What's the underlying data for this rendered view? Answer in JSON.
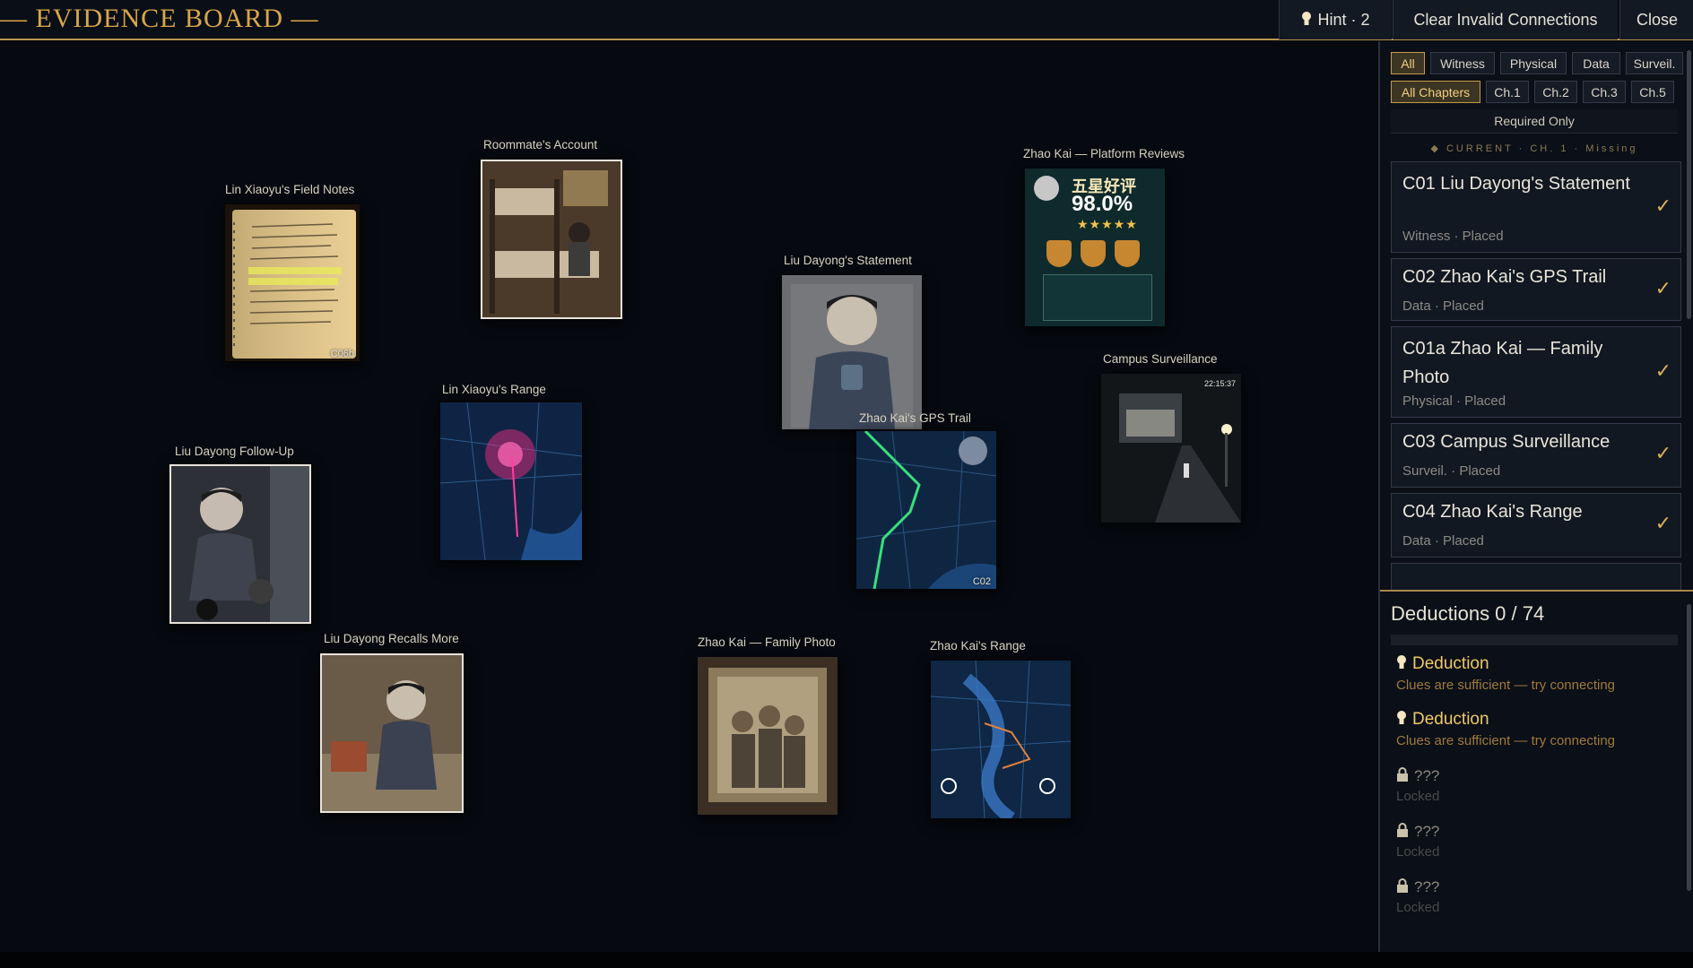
{
  "header": {
    "title": "— EVIDENCE BOARD —",
    "hint_label": "Hint · 2",
    "clear_label": "Clear Invalid Connections",
    "close_label": "Close"
  },
  "board": {
    "cards": [
      {
        "label": "Lin Xiaoyu's Field Notes",
        "code": "C06b"
      },
      {
        "label": "Roommate's Account",
        "code": ""
      },
      {
        "label": "Zhao Kai — Platform Reviews",
        "code": "",
        "badge_title": "五星好评",
        "badge_value": "98.0%"
      },
      {
        "label": "Liu Dayong's Statement",
        "code": ""
      },
      {
        "label": "Campus Surveillance",
        "code": "",
        "timestamp": "22:15:37"
      },
      {
        "label": "Lin Xiaoyu's Range",
        "code": ""
      },
      {
        "label": "Zhao Kai's GPS Trail",
        "code": "C02"
      },
      {
        "label": "Liu Dayong Follow-Up",
        "code": ""
      },
      {
        "label": "Liu Dayong Recalls More",
        "code": ""
      },
      {
        "label": "Zhao Kai — Family Photo",
        "code": ""
      },
      {
        "label": "Zhao Kai's Range",
        "code": ""
      }
    ]
  },
  "sidebar": {
    "type_filters": [
      "All",
      "Witness",
      "Physical",
      "Data",
      "Surveil."
    ],
    "chapter_filters": [
      "All Chapters",
      "Ch.1",
      "Ch.2",
      "Ch.3",
      "Ch.5"
    ],
    "required_only": "Required Only",
    "current_line": "◆ CURRENT · CH. 1 · Missing",
    "clues": [
      {
        "title": "C01  Liu Dayong's Statement",
        "sub": "Witness · Placed",
        "check": "✓"
      },
      {
        "title": "C02  Zhao Kai's GPS Trail",
        "sub": "Data · Placed",
        "check": "✓"
      },
      {
        "title": "C01a  Zhao Kai — Family Photo",
        "sub": "Physical · Placed",
        "check": "✓"
      },
      {
        "title": "C03  Campus Surveillance",
        "sub": "Surveil. · Placed",
        "check": "✓"
      },
      {
        "title": "C04  Zhao Kai's Range",
        "sub": "Data · Placed",
        "check": "✓"
      }
    ],
    "deductions": {
      "header": "Deductions  0 / 74",
      "progress": 0,
      "items": [
        {
          "title": "Deduction",
          "sub": "Clues are sufficient — try connecting",
          "locked": false
        },
        {
          "title": "Deduction",
          "sub": "Clues are sufficient — try connecting",
          "locked": false
        },
        {
          "title": "???",
          "sub": "Locked",
          "locked": true
        },
        {
          "title": "???",
          "sub": "Locked",
          "locked": true
        },
        {
          "title": "???",
          "sub": "Locked",
          "locked": true
        }
      ]
    }
  },
  "colors": {
    "accent": "#d9a648",
    "background": "#070b12",
    "check": "#d8b05c"
  }
}
